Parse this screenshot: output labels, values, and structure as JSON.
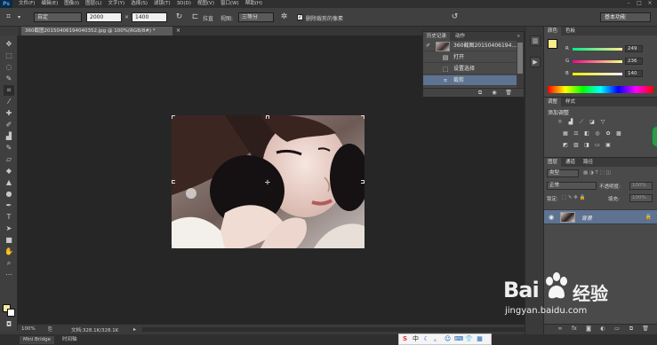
{
  "menubar": {
    "logo": "Ps",
    "items": [
      "文件(F)",
      "编辑(E)",
      "图像(I)",
      "图层(L)",
      "文字(Y)",
      "选择(S)",
      "滤镜(T)",
      "3D(D)",
      "视图(V)",
      "窗口(W)",
      "帮助(H)"
    ]
  },
  "options": {
    "preset": "自定",
    "width": "2000",
    "x_sign": "×",
    "height": "1400",
    "straighten_label": "拉直",
    "view_label": "视图:",
    "view_value": "三等分",
    "delete_pixels_label": "删除裁剪的像素",
    "workspace": "基本功能"
  },
  "document": {
    "tab_title": "360截图20150406194040352.jpg @ 100%(RGB/8#) *",
    "close": "×"
  },
  "status": {
    "zoom": "100%",
    "doc_size": "文档:328.1K/328.1K"
  },
  "bottom_tabs": [
    "Mini Bridge",
    "时间轴"
  ],
  "history": {
    "tabs": [
      "历史记录",
      "动作"
    ],
    "rows": [
      {
        "label": "360截图20150406194...",
        "icon": "snapshot-thumb"
      },
      {
        "label": "打开",
        "icon": "document-icon"
      },
      {
        "label": "设置选择",
        "icon": "selection-icon"
      },
      {
        "label": "裁剪",
        "icon": "crop-icon",
        "selected": true
      }
    ]
  },
  "color": {
    "tabs": [
      "颜色",
      "色板"
    ],
    "r_label": "R",
    "g_label": "G",
    "b_label": "B",
    "r_value": "249",
    "g_value": "236",
    "b_value": "140",
    "fg_color": "#f9ec8c"
  },
  "adjustments": {
    "tabs": [
      "调整",
      "样式"
    ],
    "title": "添加调整"
  },
  "layers": {
    "tabs": [
      "图层",
      "通道",
      "路径"
    ],
    "kind": "类型",
    "blend_mode": "正常",
    "opacity_label": "不透明度:",
    "opacity_value": "100%",
    "lock_label": "锁定:",
    "fill_label": "填充:",
    "fill_value": "100%",
    "layer_name": "背景"
  },
  "watermark": {
    "brand_left": "Bai",
    "brand_right": "经验",
    "url": "jingyan.baidu.com"
  },
  "ime": {
    "label": "中"
  },
  "accent": {
    "selection": "#5e7392",
    "canvas": "#262626",
    "panel": "#4a4a4a"
  }
}
